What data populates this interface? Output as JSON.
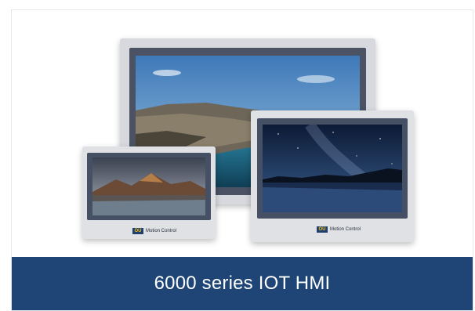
{
  "product": {
    "title": "6000 series IOT HMI",
    "brand_logo_text": "OU",
    "brand_text": "Motion Control"
  },
  "colors": {
    "footer_bg": "#1e4576",
    "device_frame": "#d9dbe0",
    "bezel_dark": "#3f4656"
  }
}
